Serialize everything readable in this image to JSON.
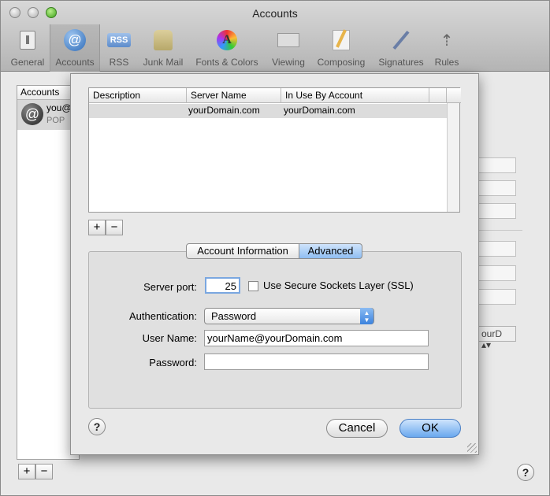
{
  "window": {
    "title": "Accounts"
  },
  "toolbar": {
    "items": [
      {
        "label": "General",
        "icon": "switch-icon"
      },
      {
        "label": "Accounts",
        "icon": "at-sign-icon"
      },
      {
        "label": "RSS",
        "icon": "rss-badge-icon"
      },
      {
        "label": "Junk Mail",
        "icon": "trash-bag-icon"
      },
      {
        "label": "Fonts & Colors",
        "icon": "color-a-icon"
      },
      {
        "label": "Viewing",
        "icon": "envelope-glasses-icon"
      },
      {
        "label": "Composing",
        "icon": "pencil-paper-icon"
      },
      {
        "label": "Signatures",
        "icon": "pen-signature-icon"
      },
      {
        "label": "Rules",
        "icon": "arrows-icon"
      }
    ]
  },
  "accounts_list": {
    "header": "Accounts",
    "items": [
      {
        "name": "you@",
        "type": "POP"
      }
    ]
  },
  "sheet": {
    "table": {
      "columns": [
        "Description",
        "Server Name",
        "In Use By Account"
      ],
      "rows": [
        {
          "description": "",
          "server_name": "yourDomain.com",
          "in_use_by": "yourDomain.com"
        }
      ]
    },
    "add_label": "+",
    "remove_label": "−",
    "tabs": {
      "account_info": "Account Information",
      "advanced": "Advanced"
    },
    "form": {
      "server_port_label": "Server port:",
      "server_port_value": "25",
      "ssl_label": "Use Secure Sockets Layer (SSL)",
      "auth_label": "Authentication:",
      "auth_value": "Password",
      "user_name_label": "User Name:",
      "user_name_value": "yourName@yourDomain.com",
      "password_label": "Password:",
      "password_value": ""
    },
    "help_label": "?",
    "cancel_label": "Cancel",
    "ok_label": "OK"
  },
  "bottom": {
    "add_label": "+",
    "remove_label": "−",
    "help_label": "?"
  },
  "background": {
    "select_value": "ourD"
  }
}
